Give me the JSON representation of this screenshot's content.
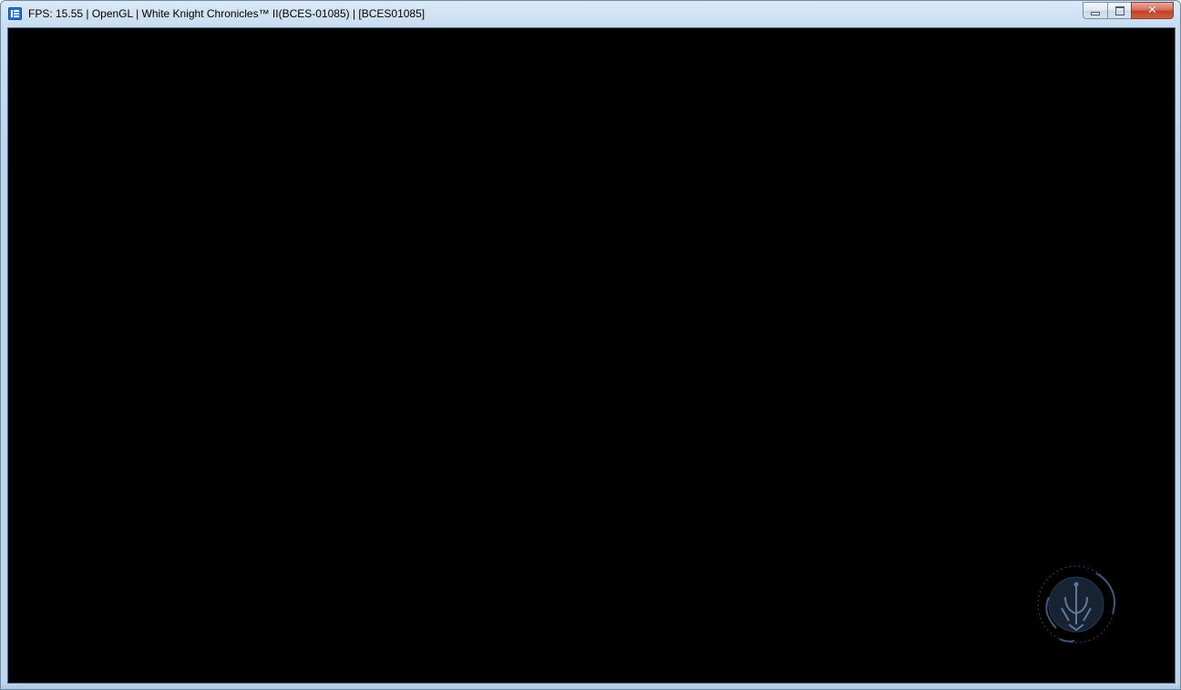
{
  "window": {
    "title": "FPS: 15.55 | OpenGL | White Knight Chronicles™ II(BCES-01085) | [BCES01085]",
    "app_icon": "rpcs3-app-icon",
    "controls": {
      "minimize_icon": "minimize-icon",
      "maximize_icon": "maximize-icon",
      "close_icon": "close-icon",
      "close_glyph": "✕"
    }
  },
  "game_view": {
    "background_color": "#000000",
    "loading_emblem_icon": "loading-emblem-icon"
  },
  "colors": {
    "titlebar": "#c8ddf1",
    "close_button": "#c0432a",
    "emblem": "#3d5a7e"
  }
}
